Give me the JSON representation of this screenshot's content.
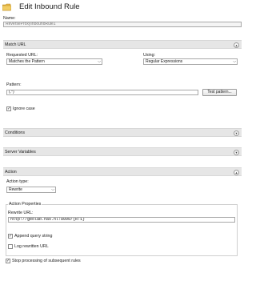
{
  "window": {
    "title": "Edit Inbound Rule",
    "icon": "folder-icon"
  },
  "name": {
    "label": "Name:",
    "value": "ReverseProxyInboundRule1"
  },
  "match_url": {
    "section_title": "Match URL",
    "requested_url_label": "Requested URL:",
    "requested_url_value": "Matches the Pattern",
    "using_label": "Using:",
    "using_value": "Regular Expressions",
    "pattern_label": "Pattern:",
    "pattern_value": "(.*)",
    "test_pattern_button": "Test pattern...",
    "ignore_case_label": "Ignore case",
    "ignore_case_checked": true
  },
  "conditions": {
    "section_title": "Conditions"
  },
  "server_variables": {
    "section_title": "Server Variables"
  },
  "action": {
    "section_title": "Action",
    "action_type_label": "Action type:",
    "action_type_value": "Rewrite",
    "properties_title": "Action Properties",
    "rewrite_url_label": "Rewrite URL:",
    "rewrite_url_value": "http://geolab.has.nl:8090/{R:1}",
    "append_query_label": "Append query string",
    "append_query_checked": true,
    "log_rewritten_label": "Log rewritten URL",
    "log_rewritten_checked": false,
    "stop_processing_label": "Stop processing of subsequent rules",
    "stop_processing_checked": true
  },
  "icons": {
    "expand": "chevron-up-icon",
    "collapsed": "chevron-down-icon",
    "dropdown": "dropdown-arrow-icon",
    "check": "checkmark-icon"
  }
}
